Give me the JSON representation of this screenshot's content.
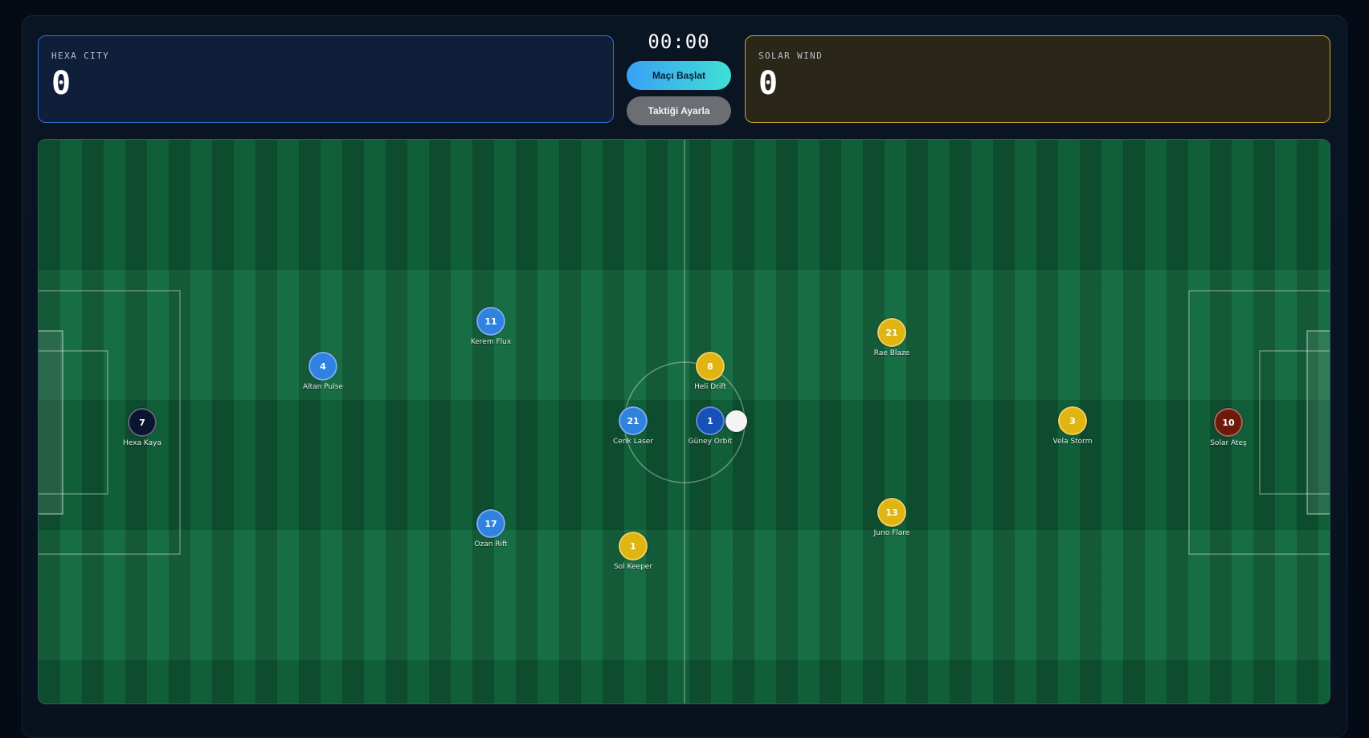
{
  "home": {
    "name": "Hexa City",
    "score": "0",
    "color": "#2f74d0"
  },
  "away": {
    "name": "Solar Wind",
    "score": "0",
    "color": "#caa522"
  },
  "clock": "00:00",
  "controls": {
    "start_label": "Maçı Başlat",
    "tactic_label": "Taktiği Ayarla"
  },
  "players": [
    {
      "number": "7",
      "name": "Hexa Kaya",
      "team": "home",
      "role": "goalkeeper",
      "color": "#0b1430"
    },
    {
      "number": "4",
      "name": "Altan Pulse",
      "team": "home",
      "role": "player",
      "color": "#2f82e0"
    },
    {
      "number": "11",
      "name": "Kerem Flux",
      "team": "home",
      "role": "player",
      "color": "#2f82e0"
    },
    {
      "number": "17",
      "name": "Ozan Rift",
      "team": "home",
      "role": "player",
      "color": "#2f82e0"
    },
    {
      "number": "21",
      "name": "Cenk Laser",
      "team": "home",
      "role": "player",
      "color": "#2f82e0"
    },
    {
      "number": "1",
      "name": "Güney Orbit",
      "team": "home",
      "role": "player",
      "color": "#1650b8"
    },
    {
      "number": "8",
      "name": "Heli Drift",
      "team": "away",
      "role": "player",
      "color": "#e0b512"
    },
    {
      "number": "1",
      "name": "Sol Keeper",
      "team": "away",
      "role": "player",
      "color": "#e0b512"
    },
    {
      "number": "21",
      "name": "Rae Blaze",
      "team": "away",
      "role": "player",
      "color": "#e0b512"
    },
    {
      "number": "13",
      "name": "Juno Flare",
      "team": "away",
      "role": "player",
      "color": "#e0b512"
    },
    {
      "number": "3",
      "name": "Vela Storm",
      "team": "away",
      "role": "player",
      "color": "#e0b512"
    },
    {
      "number": "10",
      "name": "Solar Ateş",
      "team": "away",
      "role": "goalkeeper",
      "color": "#6b1a0c"
    }
  ],
  "ball": {
    "icon": "ball-icon",
    "color": "#f4f4f4"
  }
}
